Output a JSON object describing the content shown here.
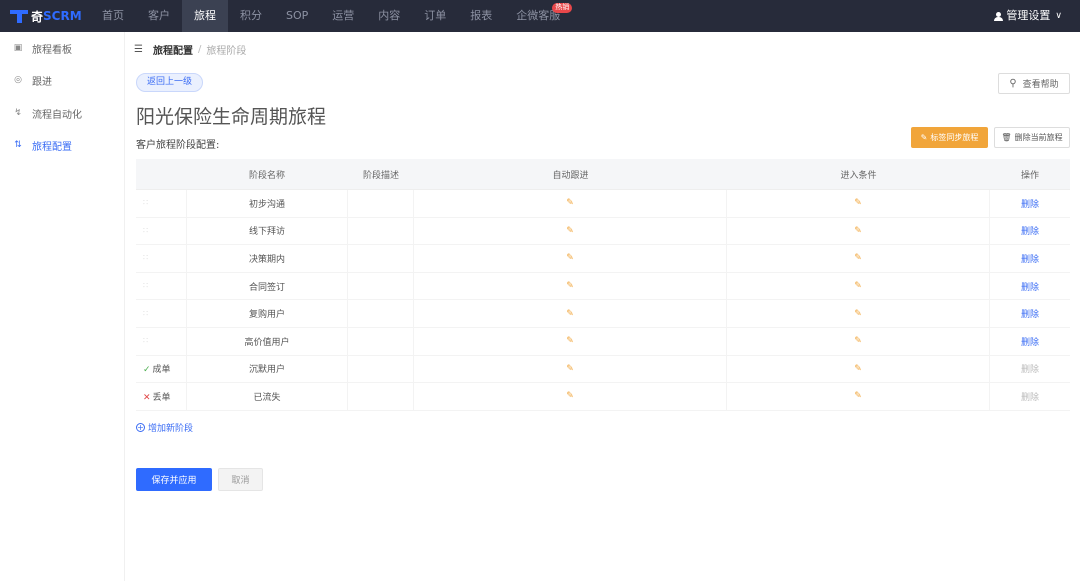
{
  "brand": {
    "logo_a": "奇",
    "logo_b": "SCRM"
  },
  "nav": {
    "items": [
      "首页",
      "客户",
      "旅程",
      "积分",
      "SOP",
      "运营",
      "内容",
      "订单",
      "报表",
      "企微客服"
    ],
    "active": "旅程",
    "badge": "热销"
  },
  "user_menu": {
    "label": "管理设置"
  },
  "sidebar": {
    "items": [
      {
        "label": "旅程看板",
        "icon": "board-icon"
      },
      {
        "label": "跟进",
        "icon": "target-icon"
      },
      {
        "label": "流程自动化",
        "icon": "flow-icon"
      },
      {
        "label": "旅程配置",
        "icon": "sliders-icon",
        "active": true
      }
    ]
  },
  "breadcrumb": {
    "level1": "旅程配置",
    "sep": "/",
    "level2": "旅程阶段"
  },
  "back_button": "返回上一级",
  "help_button": "查看帮助",
  "page_title": "阳光保险生命周期旅程",
  "section_label": "客户旅程阶段配置:",
  "actions": {
    "sync": "标签同步旅程",
    "delete_journey": "删除当前旅程"
  },
  "table": {
    "headers": [
      "",
      "阶段名称",
      "阶段描述",
      "自动跟进",
      "进入条件",
      "操作"
    ],
    "rows": [
      {
        "mark": "",
        "name": "初步沟通",
        "desc": "",
        "action": "删除",
        "disabled": false
      },
      {
        "mark": "",
        "name": "线下拜访",
        "desc": "",
        "action": "删除",
        "disabled": false
      },
      {
        "mark": "",
        "name": "决策期内",
        "desc": "",
        "action": "删除",
        "disabled": false
      },
      {
        "mark": "",
        "name": "合同签订",
        "desc": "",
        "action": "删除",
        "disabled": false
      },
      {
        "mark": "",
        "name": "复购用户",
        "desc": "",
        "action": "删除",
        "disabled": false
      },
      {
        "mark": "",
        "name": "高价值用户",
        "desc": "",
        "action": "删除",
        "disabled": false
      },
      {
        "mark": "成单",
        "mark_type": "ok",
        "name": "沉默用户",
        "desc": "",
        "action": "删除",
        "disabled": true
      },
      {
        "mark": "丢单",
        "mark_type": "x",
        "name": "已流失",
        "desc": "",
        "action": "删除",
        "disabled": true
      }
    ]
  },
  "add_stage": "增加新阶段",
  "footer": {
    "save": "保存并应用",
    "cancel": "取消"
  },
  "colors": {
    "primary": "#2f6bff",
    "warning": "#f1a53a",
    "topbar": "#272b3a"
  }
}
